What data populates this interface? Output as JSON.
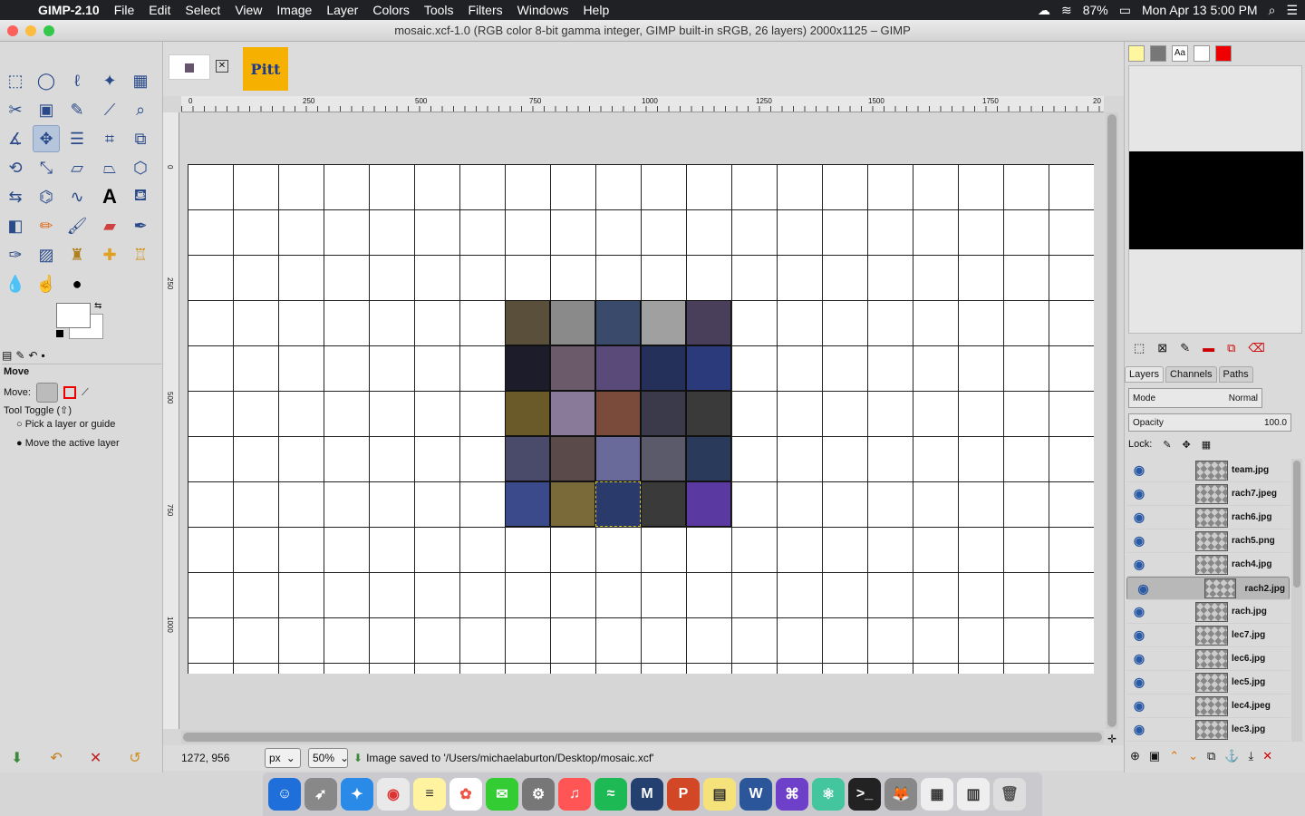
{
  "menubar": {
    "app": "GIMP-2.10",
    "items": [
      "File",
      "Edit",
      "Select",
      "View",
      "Image",
      "Layer",
      "Colors",
      "Tools",
      "Filters",
      "Windows",
      "Help"
    ],
    "battery": "87%",
    "datetime": "Mon Apr 13  5:00 PM"
  },
  "window": {
    "title": "mosaic.xcf-1.0 (RGB color 8-bit gamma integer, GIMP built-in sRGB, 26 layers) 2000x1125 – GIMP"
  },
  "toolbox": {
    "options_title": "Move",
    "move_label": "Move:",
    "tool_toggle": "Tool Toggle  (⇧)",
    "opt1": "Pick a layer or guide",
    "opt2": "Move the active layer"
  },
  "ruler": {
    "h_ticks": [
      "0",
      "250",
      "500",
      "750",
      "1000",
      "1250",
      "1500",
      "1750",
      "20"
    ],
    "v_ticks": [
      "0",
      "250",
      "500",
      "750",
      "1000"
    ]
  },
  "imagetab": {
    "logo_text": "Pitt"
  },
  "status": {
    "coords": "1272, 956",
    "unit": "px",
    "zoom": "50%",
    "message": "Image saved to '/Users/michaelaburton/Desktop/mosaic.xcf'"
  },
  "layers_panel": {
    "tabs": [
      "Layers",
      "Channels",
      "Paths"
    ],
    "mode_label": "Mode",
    "mode_value": "Normal",
    "opacity_label": "Opacity",
    "opacity_value": "100.0",
    "lock_label": "Lock:",
    "layers": [
      "team.jpg",
      "rach7.jpeg",
      "rach6.jpg",
      "rach5.png",
      "rach4.jpg",
      "rach2.jpg",
      "rach.jpg",
      "lec7.jpg",
      "lec6.jpg",
      "lec5.jpg",
      "lec4.jpeg",
      "lec3.jpg"
    ],
    "selected_index": 5
  },
  "colors": {
    "accent": "#b5c6dc",
    "canvas_bg": "#d6d6d6"
  }
}
